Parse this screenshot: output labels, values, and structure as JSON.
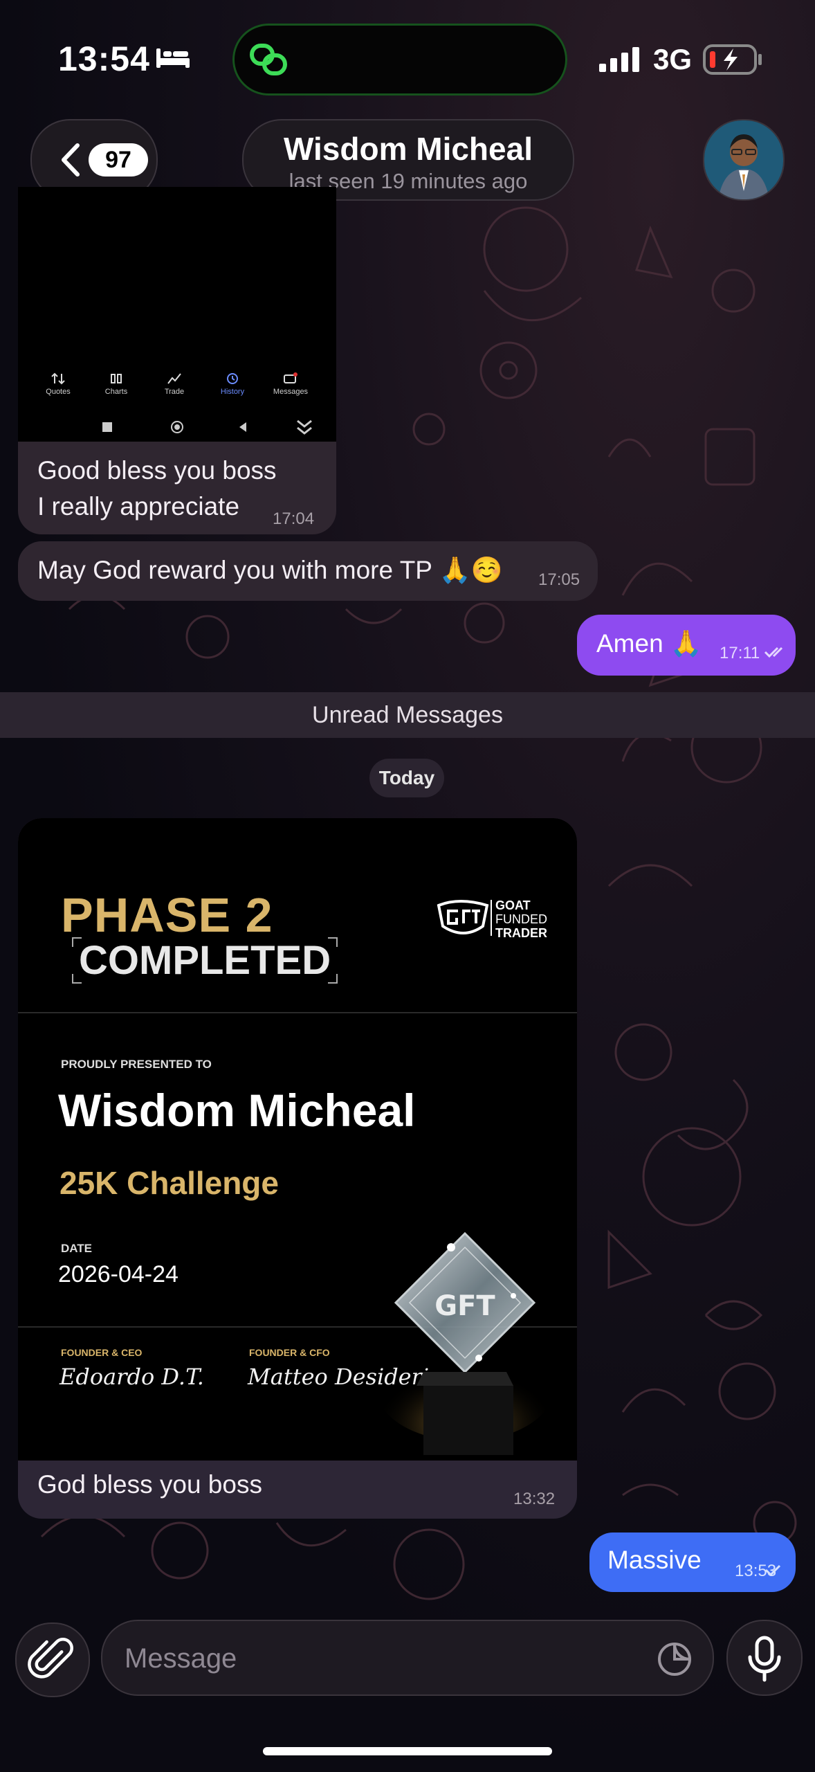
{
  "status_bar": {
    "time": "13:54",
    "network": "3G"
  },
  "header": {
    "back_badge": "97",
    "contact_name": "Wisdom Micheal",
    "last_seen": "last seen 19 minutes ago"
  },
  "screenshot_nav": {
    "items": [
      "Quotes",
      "Charts",
      "Trade",
      "History",
      "Messages"
    ],
    "active": "History"
  },
  "messages": [
    {
      "direction": "in",
      "lines": [
        "Good bless you boss",
        "I really appreciate"
      ],
      "time": "17:04"
    },
    {
      "direction": "in",
      "text": "May God reward you with more TP 🙏☺️",
      "time": "17:05"
    },
    {
      "direction": "out",
      "text": "Amen 🙏",
      "time": "17:11"
    }
  ],
  "divider": {
    "unread": "Unread Messages",
    "date": "Today"
  },
  "certificate": {
    "phase": "PHASE 2",
    "status": "COMPLETED",
    "brand_lines": [
      "GOAT",
      "FUNDED",
      "TRADER"
    ],
    "presented_label": "PROUDLY PRESENTED TO",
    "recipient": "Wisdom Micheal",
    "challenge": "25K Challenge",
    "date_label": "DATE",
    "date": "2026-04-24",
    "founder1_role": "FOUNDER & CEO",
    "founder1_sig": "Edoardo D.T.",
    "founder2_role": "FOUNDER & CFO",
    "founder2_sig": "Matteo Desideri",
    "caption": "God bless you boss",
    "time": "13:32"
  },
  "last_out": {
    "text": "Massive",
    "time": "13:53"
  },
  "composer": {
    "placeholder": "Message"
  },
  "colors": {
    "outgoing_purple": "#8e4bf0",
    "outgoing_blue": "#3e6df5",
    "incoming": "#2f2630",
    "gold": "#d9b56a"
  }
}
